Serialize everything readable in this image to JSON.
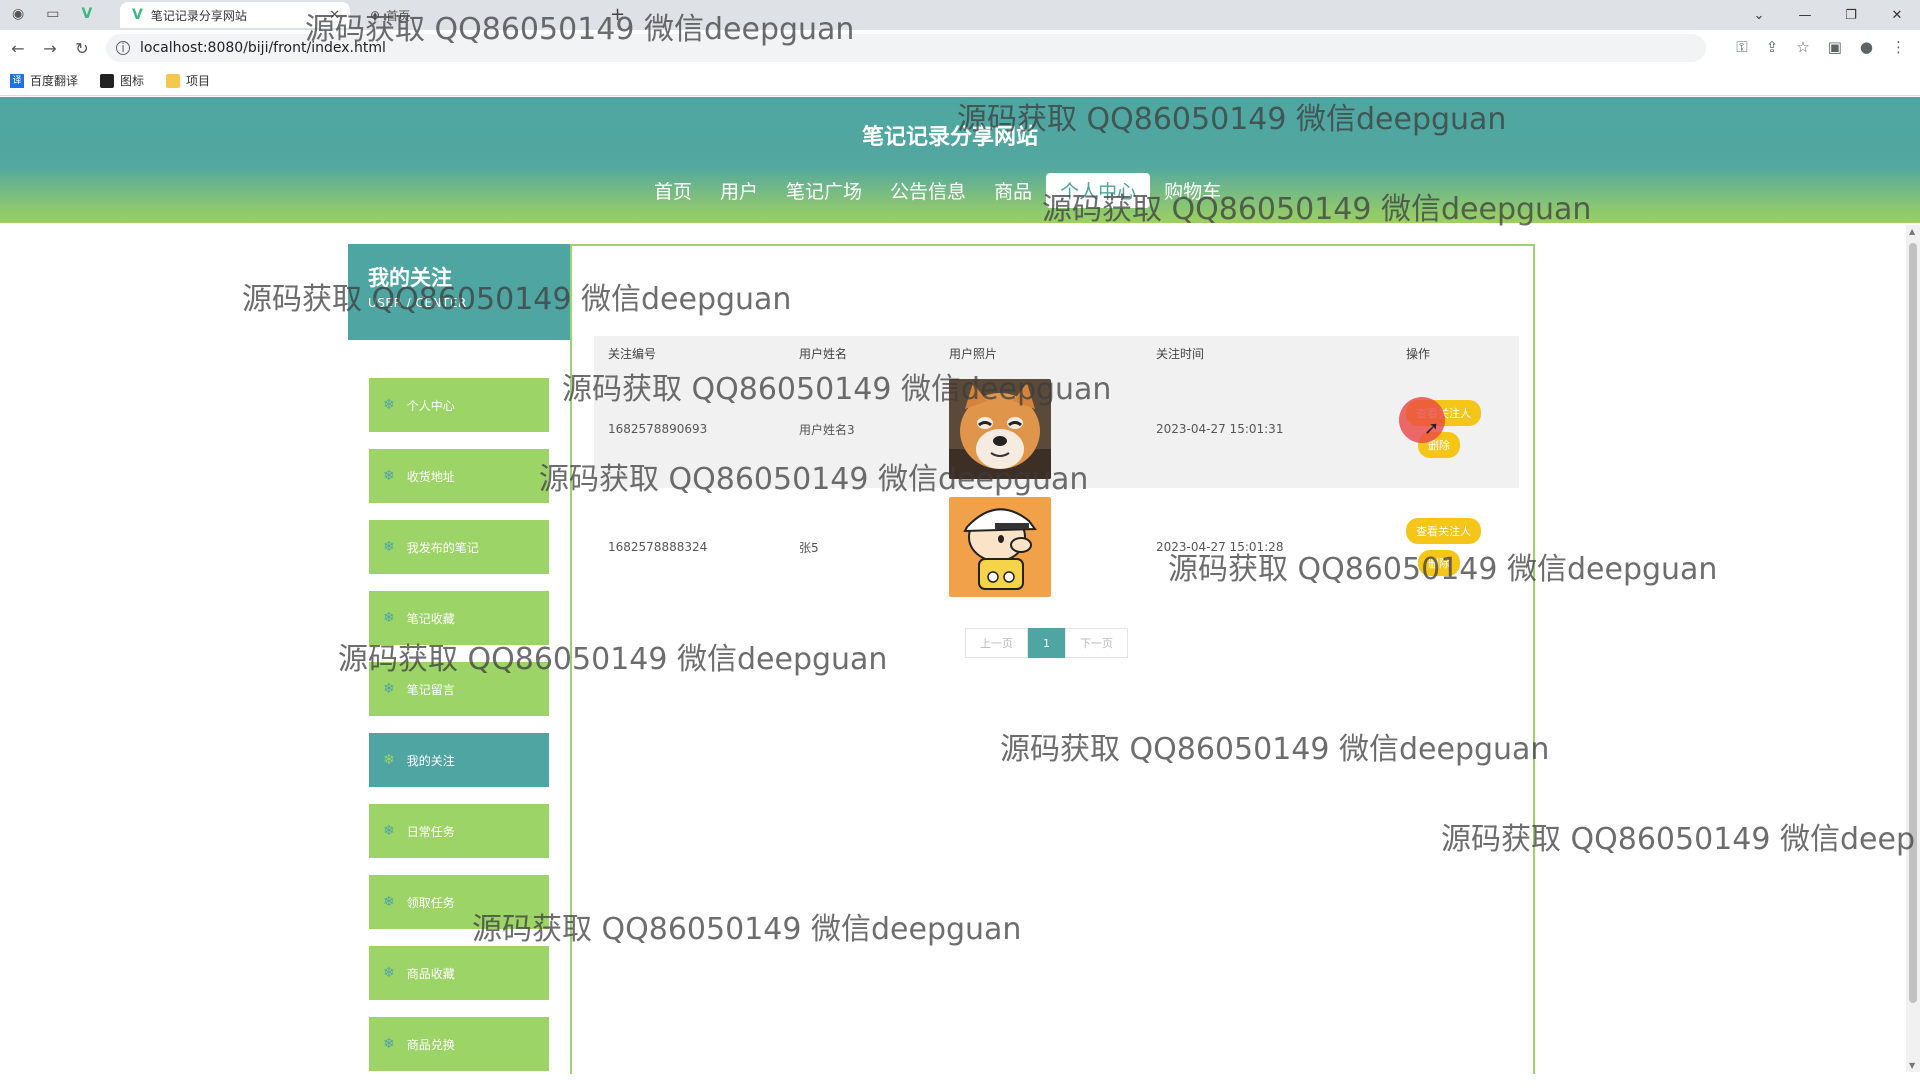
{
  "browser": {
    "tab_active_title": "笔记记录分享网站",
    "tab_second_title": "首页",
    "url": "localhost:8080/biji/front/index.html",
    "bookmarks": [
      "百度翻译",
      "图标",
      "项目"
    ]
  },
  "site": {
    "title": "笔记记录分享网站",
    "nav": [
      "首页",
      "用户",
      "笔记广场",
      "公告信息",
      "商品",
      "个人中心",
      "购物车"
    ],
    "active_nav": "个人中心"
  },
  "sidebar": {
    "title": "我的关注",
    "subtitle": "USER / CENTER",
    "items": [
      {
        "label": "个人中心"
      },
      {
        "label": "收货地址"
      },
      {
        "label": "我发布的笔记"
      },
      {
        "label": "笔记收藏"
      },
      {
        "label": "笔记留言"
      },
      {
        "label": "我的关注",
        "active": true
      },
      {
        "label": "日常任务"
      },
      {
        "label": "领取任务"
      },
      {
        "label": "商品收藏"
      },
      {
        "label": "商品兑换"
      }
    ]
  },
  "table": {
    "headers": [
      "关注编号",
      "用户姓名",
      "用户照片",
      "关注时间",
      "操作"
    ],
    "rows": [
      {
        "id": "1682578890693",
        "name": "用户姓名3",
        "photo": "shiba-dog",
        "time": "2023-04-27 15:01:31",
        "actions": [
          "查看关注人",
          "删除"
        ]
      },
      {
        "id": "1682578888324",
        "name": "张5",
        "photo": "cartoon-boy",
        "time": "2023-04-27 15:01:28",
        "actions": [
          "查看关注人",
          "删除"
        ]
      }
    ]
  },
  "pagination": {
    "prev": "上一页",
    "current": "1",
    "next": "下一页"
  },
  "watermark_text": "源码获取 QQ86050149 微信deepguan",
  "colors": {
    "primary": "#4fa5a1",
    "accent_green": "#9dd468",
    "button_yellow": "#f5c518"
  }
}
